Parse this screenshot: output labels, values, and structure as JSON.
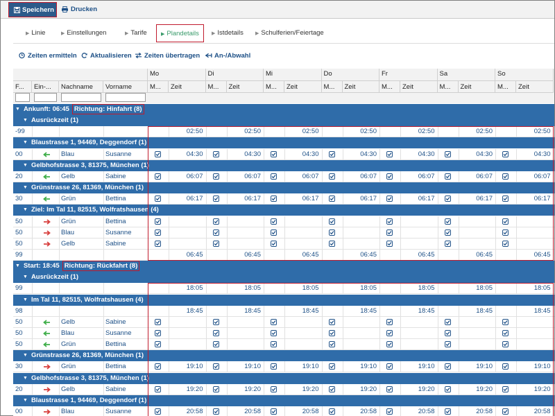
{
  "toolbar": {
    "save_label": "Speichern",
    "print_label": "Drucken"
  },
  "tabs": [
    {
      "label": "Linie",
      "active": false
    },
    {
      "label": "Einstellungen",
      "active": false
    },
    {
      "label": "Tarife",
      "active": false
    },
    {
      "label": "Plandetails",
      "active": true
    },
    {
      "label": "Istdetails",
      "active": false
    },
    {
      "label": "Schulferien/Feiertage",
      "active": false
    }
  ],
  "actions": [
    {
      "label": "Zeiten ermitteln",
      "icon": "clock-icon"
    },
    {
      "label": "Aktualisieren",
      "icon": "refresh-icon"
    },
    {
      "label": "Zeiten übertragen",
      "icon": "transfer-icon"
    },
    {
      "label": "An-/Abwahl",
      "icon": "select-toggle-icon"
    }
  ],
  "columns": {
    "f": "F...",
    "ein": "Ein-...",
    "nachname": "Nachname",
    "vorname": "Vorname",
    "m": "M...",
    "zeit": "Zeit"
  },
  "days": [
    "Mo",
    "Di",
    "Mi",
    "Do",
    "Fr",
    "Sa",
    "So"
  ],
  "sections": [
    {
      "label": "Ankunft: 06:45",
      "tag": "Richtung: Hinfahrt (8)",
      "groups": [
        {
          "label": "Ausrückzeit (1)",
          "rows": [
            {
              "f": "-99",
              "arrow": "",
              "nachname": "",
              "vorname": "",
              "check": false,
              "times": [
                "02:50",
                "02:50",
                "02:50",
                "02:50",
                "02:50",
                "02:50",
                "02:50"
              ]
            }
          ]
        },
        {
          "label": "Blaustrasse 1, 94469, Deggendorf (1)",
          "rows": [
            {
              "f": "00",
              "arrow": "left",
              "nachname": "Blau",
              "vorname": "Susanne",
              "check": true,
              "times": [
                "04:30",
                "04:30",
                "04:30",
                "04:30",
                "04:30",
                "04:30",
                "04:30"
              ]
            }
          ]
        },
        {
          "label": "Gelbhofstrasse 3, 81375, München (1)",
          "rows": [
            {
              "f": "20",
              "arrow": "left",
              "nachname": "Gelb",
              "vorname": "Sabine",
              "check": true,
              "times": [
                "06:07",
                "06:07",
                "06:07",
                "06:07",
                "06:07",
                "06:07",
                "06:07"
              ]
            }
          ]
        },
        {
          "label": "Grünstrasse 26, 81369, München (1)",
          "rows": [
            {
              "f": "30",
              "arrow": "left",
              "nachname": "Grün",
              "vorname": "Bettina",
              "check": true,
              "times": [
                "06:17",
                "06:17",
                "06:17",
                "06:17",
                "06:17",
                "06:17",
                "06:17"
              ]
            }
          ]
        },
        {
          "label": "Ziel: Im Tal 11, 82515, Wolfratshausen (4)",
          "rows": [
            {
              "f": "50",
              "arrow": "right",
              "nachname": "Grün",
              "vorname": "Bettina",
              "check": true,
              "times": [
                "",
                "",
                "",
                "",
                "",
                "",
                ""
              ]
            },
            {
              "f": "50",
              "arrow": "right",
              "nachname": "Blau",
              "vorname": "Susanne",
              "check": true,
              "times": [
                "",
                "",
                "",
                "",
                "",
                "",
                ""
              ]
            },
            {
              "f": "50",
              "arrow": "right",
              "nachname": "Gelb",
              "vorname": "Sabine",
              "check": true,
              "times": [
                "",
                "",
                "",
                "",
                "",
                "",
                ""
              ]
            },
            {
              "f": "99",
              "arrow": "",
              "nachname": "",
              "vorname": "",
              "check": false,
              "times": [
                "06:45",
                "06:45",
                "06:45",
                "06:45",
                "06:45",
                "06:45",
                "06:45"
              ]
            }
          ]
        }
      ]
    },
    {
      "label": "Start: 18:45",
      "tag": "Richtung: Rückfahrt (8)",
      "groups": [
        {
          "label": "Ausrückzeit (1)",
          "rows": [
            {
              "f": "99",
              "arrow": "",
              "nachname": "",
              "vorname": "",
              "check": false,
              "times": [
                "18:05",
                "18:05",
                "18:05",
                "18:05",
                "18:05",
                "18:05",
                "18:05"
              ]
            }
          ]
        },
        {
          "label": "Im Tal 11, 82515, Wolfratshausen (4)",
          "rows": [
            {
              "f": "98",
              "arrow": "",
              "nachname": "",
              "vorname": "",
              "check": false,
              "times": [
                "18:45",
                "18:45",
                "18:45",
                "18:45",
                "18:45",
                "18:45",
                "18:45"
              ]
            },
            {
              "f": "50",
              "arrow": "left",
              "nachname": "Gelb",
              "vorname": "Sabine",
              "check": true,
              "times": [
                "",
                "",
                "",
                "",
                "",
                "",
                ""
              ]
            },
            {
              "f": "50",
              "arrow": "left",
              "nachname": "Blau",
              "vorname": "Susanne",
              "check": true,
              "times": [
                "",
                "",
                "",
                "",
                "",
                "",
                ""
              ]
            },
            {
              "f": "50",
              "arrow": "left",
              "nachname": "Grün",
              "vorname": "Bettina",
              "check": true,
              "times": [
                "",
                "",
                "",
                "",
                "",
                "",
                ""
              ]
            }
          ]
        },
        {
          "label": "Grünstrasse 26, 81369, München (1)",
          "rows": [
            {
              "f": "30",
              "arrow": "right",
              "nachname": "Grün",
              "vorname": "Bettina",
              "check": true,
              "times": [
                "19:10",
                "19:10",
                "19:10",
                "19:10",
                "19:10",
                "19:10",
                "19:10"
              ]
            }
          ]
        },
        {
          "label": "Gelbhofstrasse 3, 81375, München (1)",
          "rows": [
            {
              "f": "20",
              "arrow": "right",
              "nachname": "Gelb",
              "vorname": "Sabine",
              "check": true,
              "times": [
                "19:20",
                "19:20",
                "19:20",
                "19:20",
                "19:20",
                "19:20",
                "19:20"
              ]
            }
          ]
        },
        {
          "label": "Blaustrasse 1, 94469, Deggendorf (1)",
          "rows": [
            {
              "f": "00",
              "arrow": "right",
              "nachname": "Blau",
              "vorname": "Susanne",
              "check": true,
              "times": [
                "20:58",
                "20:58",
                "20:58",
                "20:58",
                "20:58",
                "20:58",
                "20:58"
              ]
            }
          ]
        }
      ]
    }
  ],
  "colors": {
    "accent": "#2f6ca9",
    "highlight": "#c01a2c",
    "arrow_left": "#3fae49",
    "arrow_right": "#d8403f",
    "text": "#1c4f86"
  }
}
